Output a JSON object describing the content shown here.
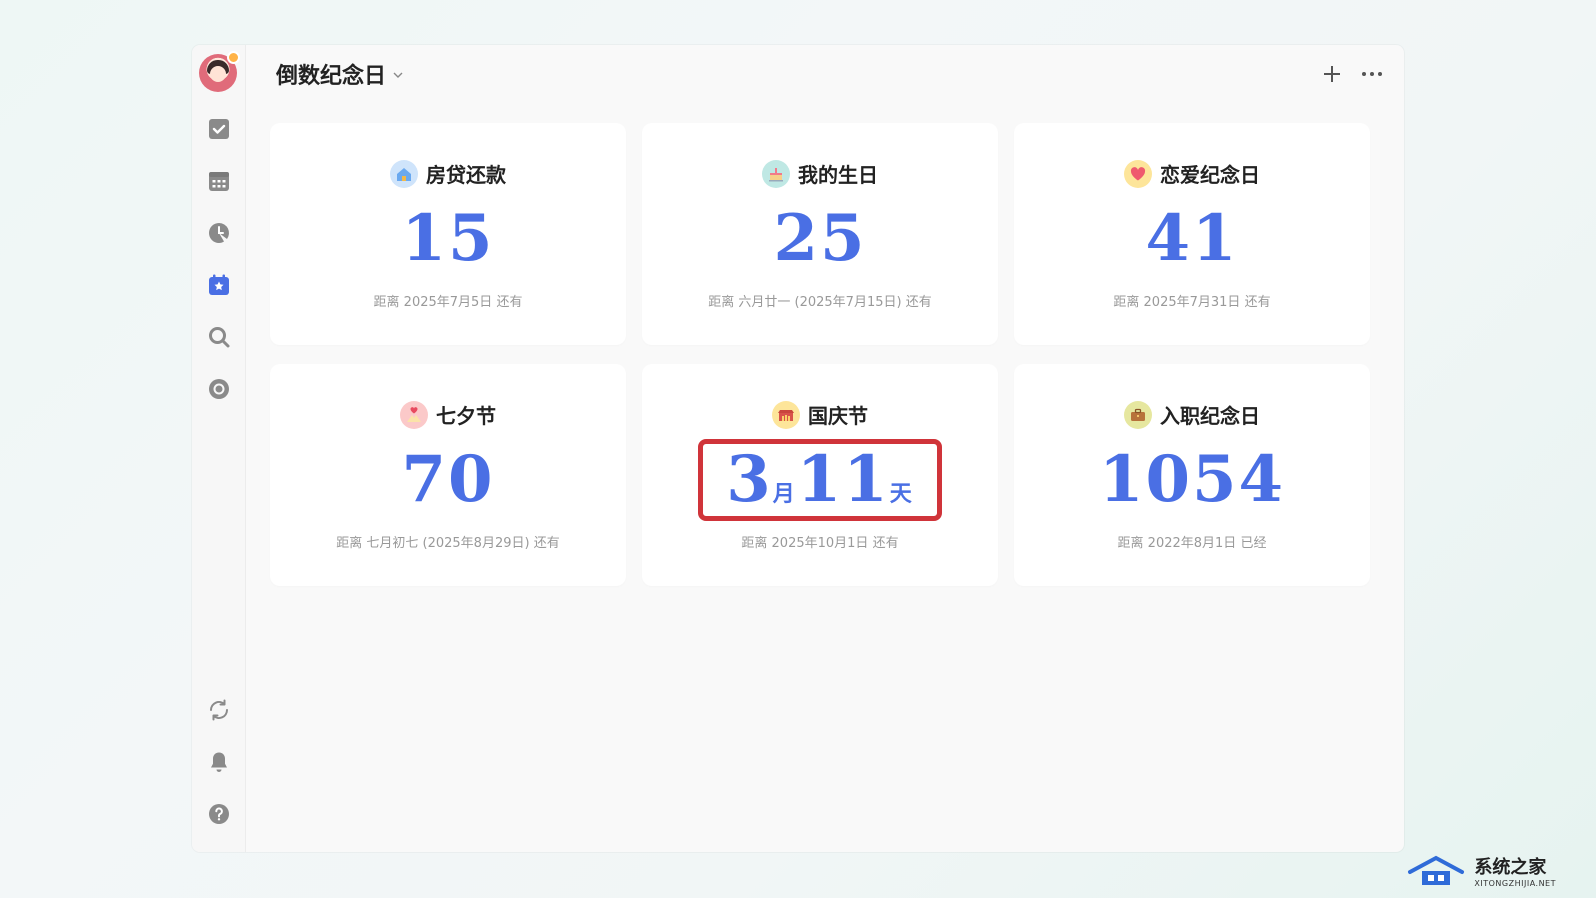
{
  "header": {
    "title": "倒数纪念日",
    "add_label": "+",
    "more_label": "···"
  },
  "sidebar": {
    "items": [
      {
        "name": "tasks",
        "icon": "checkbox-icon"
      },
      {
        "name": "calendar",
        "icon": "calendar-grid-icon"
      },
      {
        "name": "pomodoro",
        "icon": "clock-icon"
      },
      {
        "name": "countdown",
        "icon": "star-calendar-icon",
        "active": true
      },
      {
        "name": "search",
        "icon": "search-icon"
      },
      {
        "name": "habit",
        "icon": "circle-target-icon"
      }
    ],
    "bottom": [
      {
        "name": "sync",
        "icon": "sync-icon"
      },
      {
        "name": "notifications",
        "icon": "bell-icon"
      },
      {
        "name": "help",
        "icon": "help-icon"
      }
    ]
  },
  "cards": [
    {
      "name": "房贷还款",
      "number": "15",
      "sub": "距离 2025年7月5日 还有",
      "icon": "house-icon"
    },
    {
      "name": "我的生日",
      "number": "25",
      "sub": "距离 六月廿一 (2025年7月15日) 还有",
      "icon": "cake-icon"
    },
    {
      "name": "恋爱纪念日",
      "number": "41",
      "sub": "距离 2025年7月31日 还有",
      "icon": "heart-icon"
    },
    {
      "name": "七夕节",
      "number": "70",
      "sub": "距离 七月初七 (2025年8月29日) 还有",
      "icon": "couple-icon"
    },
    {
      "name": "国庆节",
      "number_parts": [
        "3",
        "月",
        "11",
        "天"
      ],
      "sub": "距离 2025年10月1日 还有",
      "icon": "gate-icon"
    },
    {
      "name": "入职纪念日",
      "number": "1054",
      "sub": "距离 2022年8月1日 已经",
      "icon": "briefcase-icon"
    }
  ],
  "watermark": {
    "cn": "系统之家",
    "en": "XITONGZHIJIA.NET"
  },
  "colors": {
    "accent": "#4a6fe4",
    "highlight": "#d0343a"
  }
}
